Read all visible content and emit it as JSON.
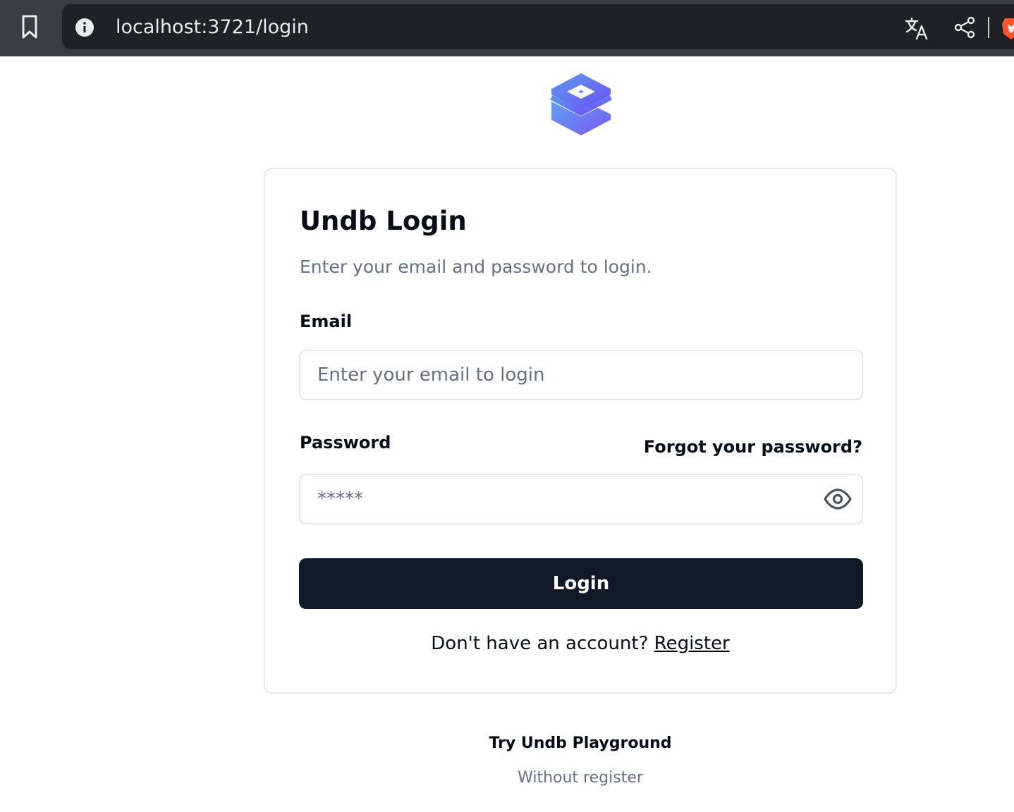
{
  "browser": {
    "url": "localhost:3721/login"
  },
  "login": {
    "title": "Undb Login",
    "subtitle": "Enter your email and password to login.",
    "email_label": "Email",
    "email_placeholder": "Enter your email to login",
    "email_value": "",
    "password_label": "Password",
    "forgot_link": "Forgot your password?",
    "password_placeholder": "*****",
    "password_value": "",
    "login_button": "Login",
    "register_prompt": "Don't have an account?",
    "register_link": "Register"
  },
  "playground": {
    "title": "Try Undb Playground",
    "subtitle": "Without register"
  },
  "icons": {
    "bookmark": "bookmark-icon",
    "info": "info-icon",
    "translate": "translate-icon",
    "share": "share-icon",
    "brave": "brave-logo-icon",
    "logo": "undb-logo",
    "eye": "eye-icon"
  },
  "colors": {
    "primary_button": "#111827",
    "logo_top": "#5b8def",
    "logo_bottom": "#6d5ef5",
    "muted_text": "#667085"
  }
}
